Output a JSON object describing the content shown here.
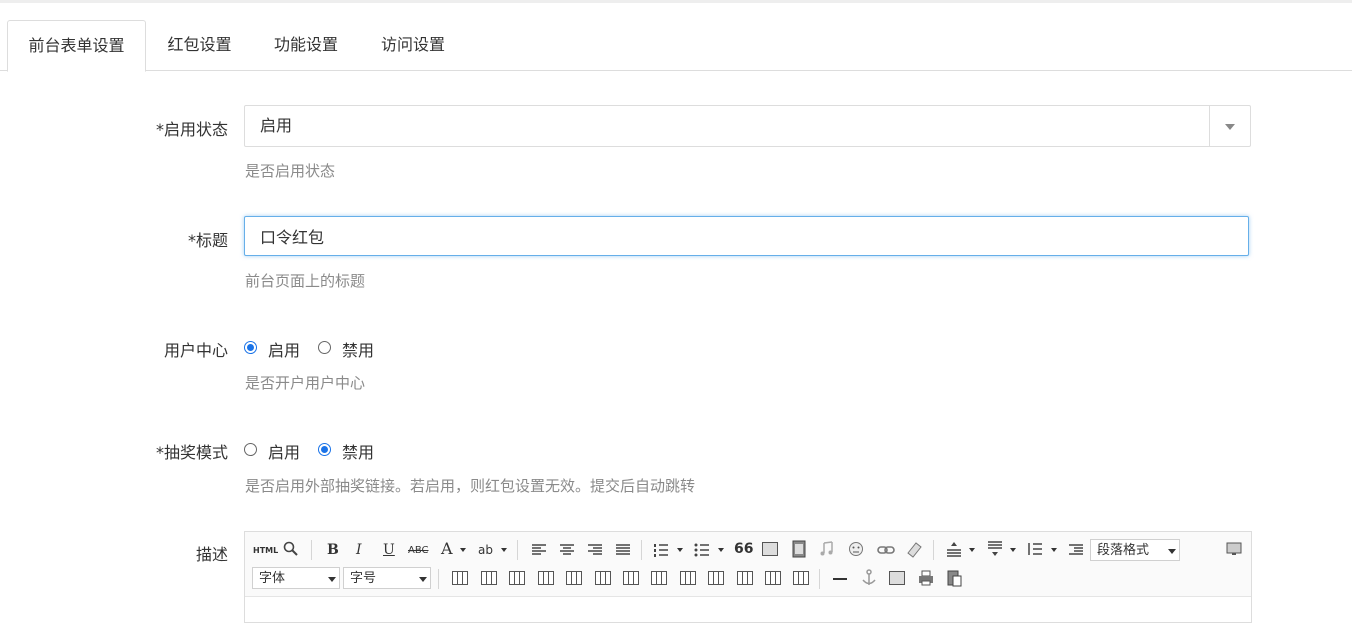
{
  "tabs": [
    {
      "label": "前台表单设置",
      "active": true
    },
    {
      "label": "红包设置",
      "active": false
    },
    {
      "label": "功能设置",
      "active": false
    },
    {
      "label": "访问设置",
      "active": false
    }
  ],
  "form": {
    "status": {
      "label": "*启用状态",
      "value": "启用",
      "help": "是否启用状态"
    },
    "title": {
      "label": "*标题",
      "value": "口令红包",
      "help": "前台页面上的标题"
    },
    "user_center": {
      "label": "用户中心",
      "options": [
        "启用",
        "禁用"
      ],
      "selected": "启用",
      "help": "是否开户用户中心"
    },
    "lottery_mode": {
      "label": "*抽奖模式",
      "options": [
        "启用",
        "禁用"
      ],
      "selected": "禁用",
      "help": "是否启用外部抽奖链接。若启用，则红包设置无效。提交后自动跳转"
    },
    "description": {
      "label": "描述"
    }
  },
  "editor": {
    "html_label": "HTML",
    "bold": "B",
    "italic": "I",
    "underline": "U",
    "strike": "ABC",
    "font_color": "A",
    "backcolor": "ab",
    "quote": "66",
    "paragraph_format": "段落格式",
    "font_family": "字体",
    "font_size": "字号",
    "accent_color": "#1a73e8"
  }
}
